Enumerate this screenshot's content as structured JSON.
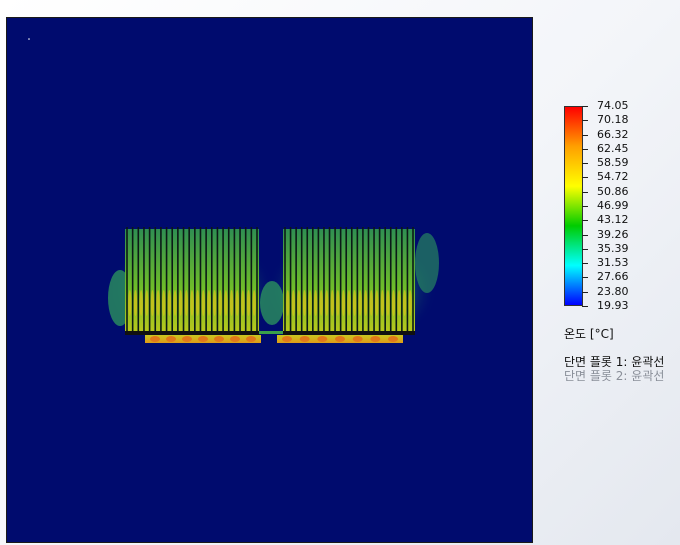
{
  "legend": {
    "ticks": [
      "74.05",
      "70.18",
      "66.32",
      "62.45",
      "58.59",
      "54.72",
      "50.86",
      "46.99",
      "43.12",
      "39.26",
      "35.39",
      "31.53",
      "27.66",
      "23.80",
      "19.93"
    ],
    "unit_label": "온도 [°C]",
    "plot_items": [
      {
        "label": "단면 플롯 1: 윤곽선",
        "active": true
      },
      {
        "label": "단면 플롯 2: 윤곽선",
        "active": false
      }
    ],
    "colormap": [
      "#ff0000",
      "#ffa000",
      "#ffff00",
      "#00cc00",
      "#00ffff",
      "#0000ff"
    ]
  },
  "viewport": {
    "background": "#000b6e",
    "heat_sinks": [
      {
        "name": "left",
        "fin_count": 24
      },
      {
        "name": "right",
        "fin_count": 24
      }
    ]
  }
}
